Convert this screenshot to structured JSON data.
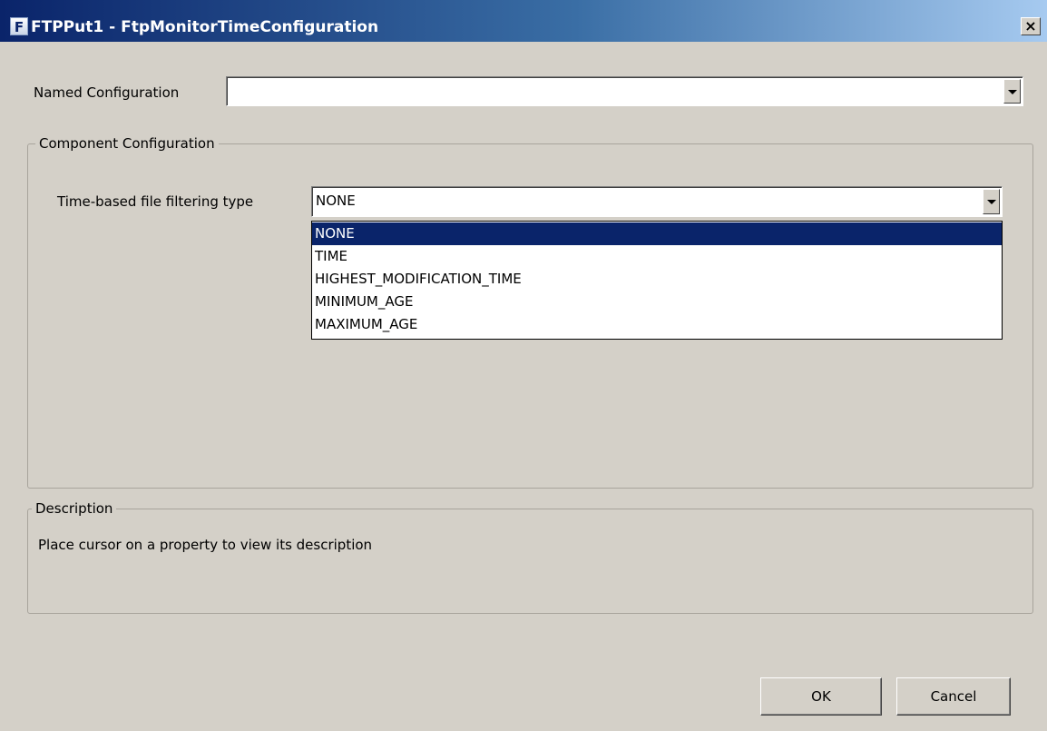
{
  "window": {
    "icon": "app-icon",
    "icon_glyph": "F",
    "title": "FTPPut1 - FtpMonitorTimeConfiguration",
    "close_glyph": "×"
  },
  "named_configuration": {
    "label": "Named Configuration",
    "value": ""
  },
  "component_configuration": {
    "legend": "Component Configuration",
    "filter_type": {
      "label": "Time-based file filtering type",
      "value": "NONE",
      "options": [
        "NONE",
        "TIME",
        "HIGHEST_MODIFICATION_TIME",
        "MINIMUM_AGE",
        "MAXIMUM_AGE"
      ],
      "selected_index": 0
    }
  },
  "description": {
    "legend": "Description",
    "text": "Place cursor on a property to view its description"
  },
  "buttons": {
    "ok": "OK",
    "cancel": "Cancel"
  },
  "colors": {
    "title_gradient_start": "#0a246a",
    "title_gradient_end": "#a6caf0",
    "selection": "#0a246a",
    "dialog_background": "#d4d0c8"
  }
}
